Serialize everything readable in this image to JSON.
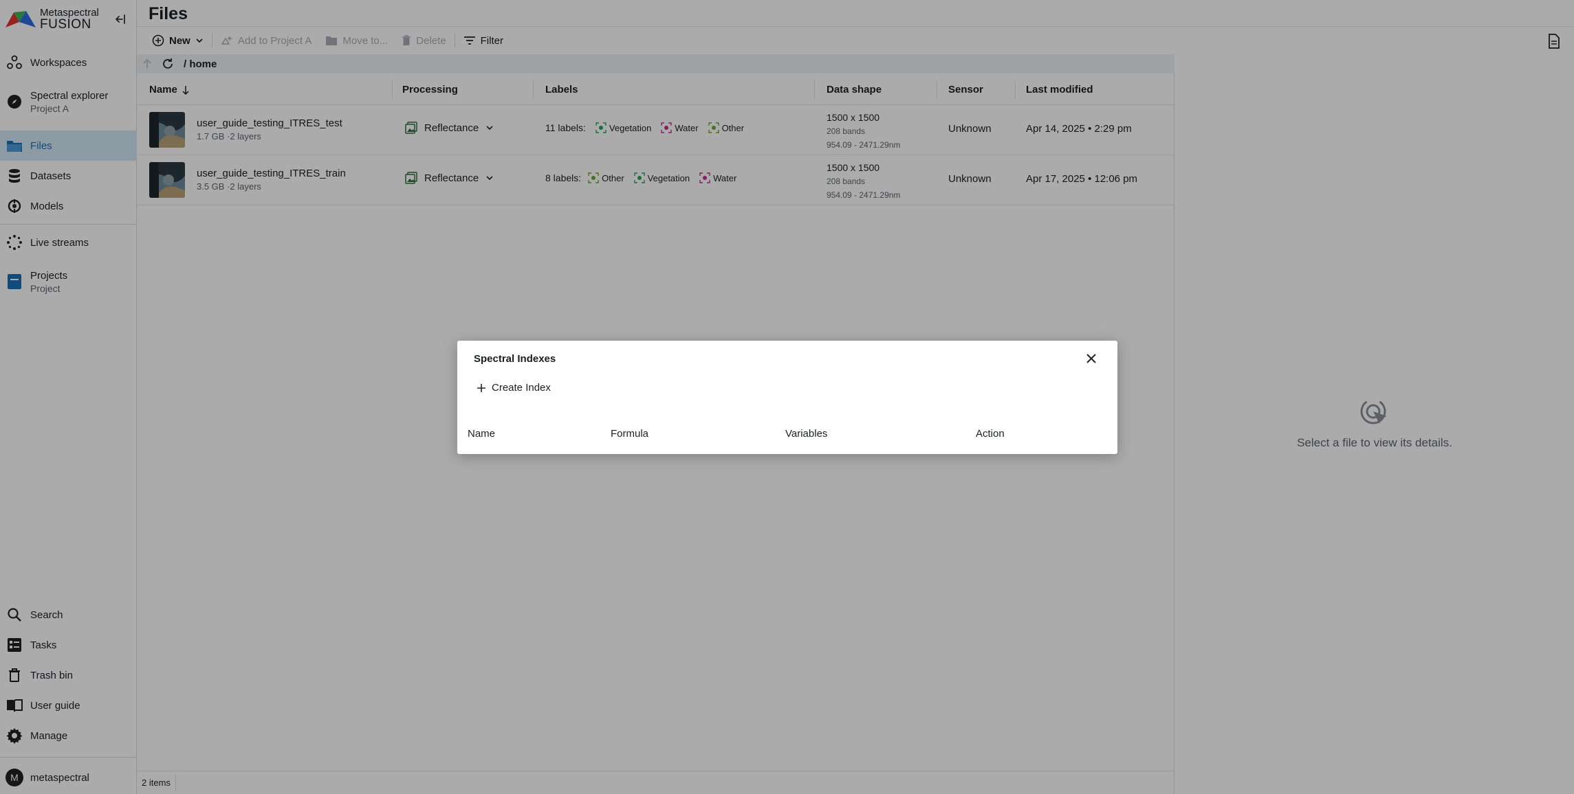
{
  "app": {
    "brand_line1": "Metaspectral",
    "brand_line2": "FUSION",
    "brand_colors": {
      "red": "#e5322f",
      "green": "#2fa84f",
      "blue": "#2d6cdf"
    }
  },
  "sidebar": {
    "items": [
      {
        "label": "Workspaces",
        "icon": "workspaces-icon"
      },
      {
        "label": "Spectral explorer",
        "sub": "Project A",
        "icon": "compass-icon"
      },
      {
        "label": "Files",
        "icon": "folder-icon",
        "active": true
      },
      {
        "label": "Datasets",
        "icon": "database-icon"
      },
      {
        "label": "Models",
        "icon": "models-icon"
      },
      {
        "label": "Live streams",
        "icon": "live-streams-icon"
      },
      {
        "label": "Projects",
        "sub": "Project",
        "icon": "projects-icon"
      }
    ],
    "bottom_items": [
      {
        "label": "Search",
        "icon": "search-icon"
      },
      {
        "label": "Tasks",
        "icon": "tasks-icon"
      },
      {
        "label": "Trash bin",
        "icon": "trash-icon"
      },
      {
        "label": "User guide",
        "icon": "book-icon"
      },
      {
        "label": "Manage",
        "icon": "gear-icon"
      }
    ],
    "user": {
      "initial": "M",
      "name": "metaspectral"
    }
  },
  "page": {
    "title": "Files"
  },
  "toolbar": {
    "new_label": "New",
    "add_to_project_label": "Add to Project A",
    "move_label": "Move to...",
    "delete_label": "Delete",
    "filter_label": "Filter"
  },
  "pathbar": {
    "path": "/ home"
  },
  "table": {
    "headers": {
      "name": "Name",
      "processing": "Processing",
      "labels": "Labels",
      "data_shape": "Data shape",
      "sensor": "Sensor",
      "last_modified": "Last modified"
    },
    "rows": [
      {
        "name": "user_guide_testing_ITRES_test",
        "meta": "1.7 GB ·2 layers",
        "processing": "Reflectance",
        "labels_count": "11 labels:",
        "labels": [
          "Vegetation",
          "Water",
          "Other"
        ],
        "shape": "1500 x 1500",
        "bands": "208 bands",
        "range": "954.09 - 2471.29nm",
        "sensor": "Unknown",
        "modified": "Apr 14, 2025 • 2:29 pm"
      },
      {
        "name": "user_guide_testing_ITRES_train",
        "meta": "3.5 GB ·2 layers",
        "processing": "Reflectance",
        "labels_count": "8 labels:",
        "labels": [
          "Other",
          "Vegetation",
          "Water"
        ],
        "shape": "1500 x 1500",
        "bands": "208 bands",
        "range": "954.09 - 2471.29nm",
        "sensor": "Unknown",
        "modified": "Apr 17, 2025 • 12:06 pm"
      }
    ]
  },
  "label_colors": {
    "Vegetation": "#27a556",
    "Water": "#c2318f",
    "Other": "#6aab2e"
  },
  "status": {
    "items_count": "2 items"
  },
  "detail": {
    "empty_message": "Select a file to view its details."
  },
  "modal": {
    "title": "Spectral Indexes",
    "create_label": "Create Index",
    "columns": [
      "Name",
      "Formula",
      "Variables",
      "Action"
    ]
  }
}
